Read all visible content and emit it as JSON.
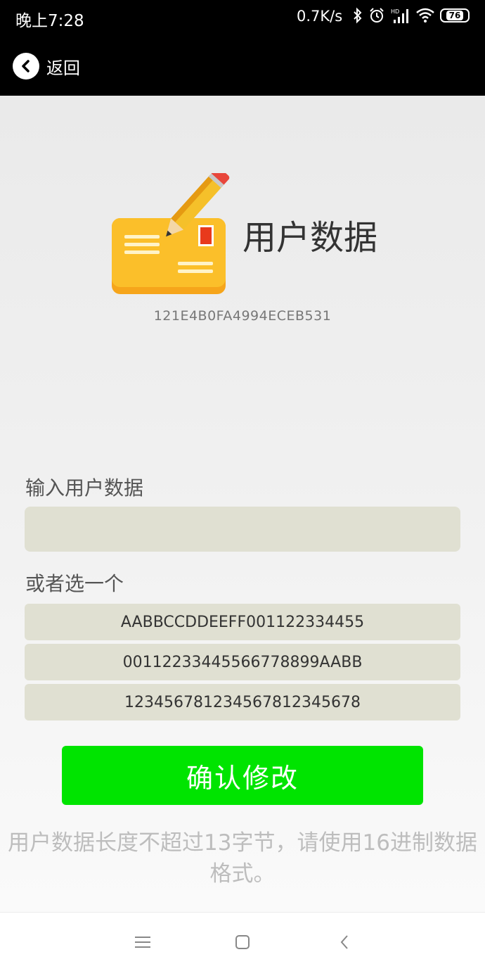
{
  "status_bar": {
    "time": "晚上7:28",
    "network_speed": "0.7K/s",
    "battery_level": "76",
    "icons": [
      "bluetooth-icon",
      "alarm-icon",
      "signal-hd-icon",
      "wifi-icon",
      "battery-icon"
    ]
  },
  "top_bar": {
    "back_label": "返回"
  },
  "header": {
    "title": "用户数据",
    "device_id": "121E4B0FA4994ECEB531",
    "logo_icon": "envelope-pencil-icon"
  },
  "form": {
    "input_label": "输入用户数据",
    "input_value": "",
    "choose_label": "或者选一个",
    "options": [
      "AABBCCDDEEFF001122334455",
      "00112233445566778899AABB",
      "123456781234567812345678"
    ],
    "confirm_label": "确认修改",
    "hint": "用户数据长度不超过13字节，请使用16进制数据格式。"
  },
  "nav_bar": {
    "icons": [
      "menu-icon",
      "home-icon",
      "back-icon"
    ]
  },
  "colors": {
    "confirm_button": "#00e400",
    "field_background": "#e0e0d2",
    "top_bar": "#000000",
    "hint_text": "#bdbdbd"
  }
}
